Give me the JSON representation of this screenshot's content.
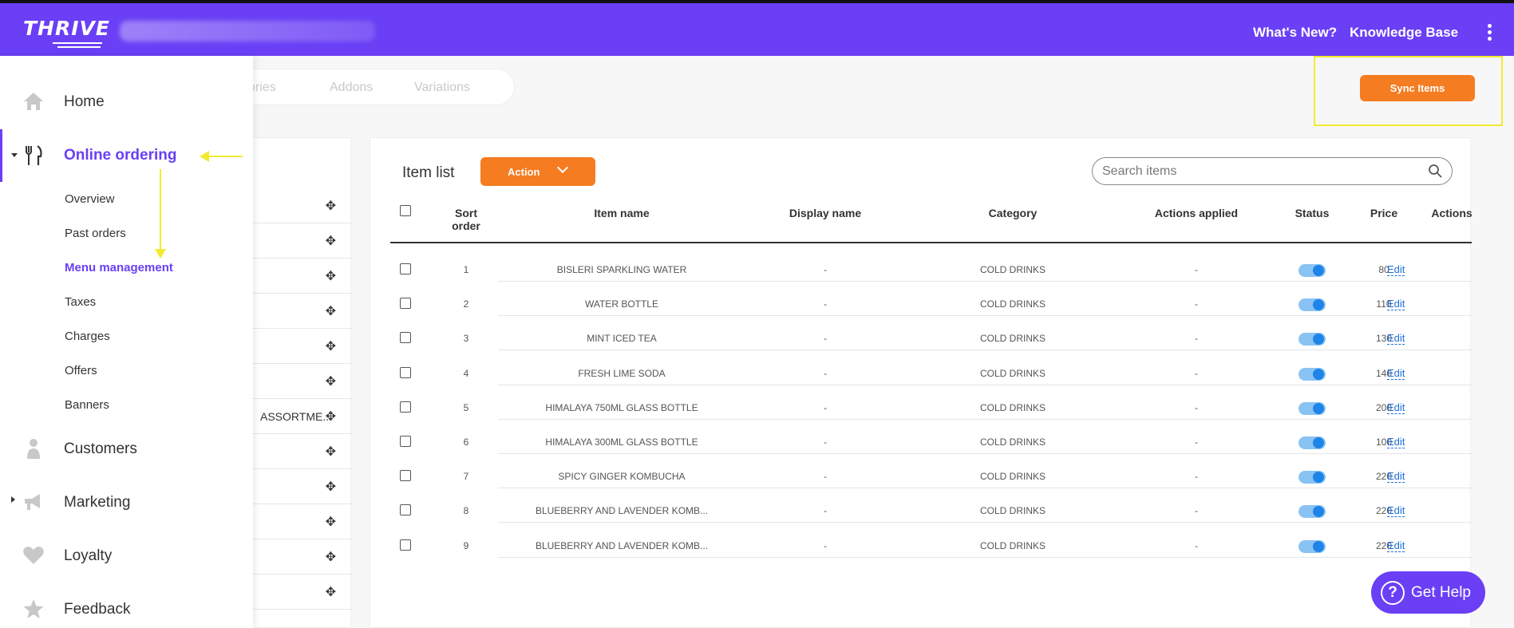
{
  "header": {
    "logo": "THRIVE",
    "links": [
      "What's New?",
      "Knowledge Base"
    ]
  },
  "tabs": [
    "ories",
    "Addons",
    "Variations"
  ],
  "sync_button": "Sync Items",
  "sidebar": {
    "main": [
      {
        "label": "Home",
        "icon": "home-icon"
      },
      {
        "label": "Online ordering",
        "icon": "fork-knife-icon"
      },
      {
        "label": "Customers",
        "icon": "user-icon"
      },
      {
        "label": "Marketing",
        "icon": "megaphone-icon"
      },
      {
        "label": "Loyalty",
        "icon": "heart-icon"
      },
      {
        "label": "Feedback",
        "icon": "star-icon"
      }
    ],
    "sub": [
      "Overview",
      "Past orders",
      "Menu management",
      "Taxes",
      "Charges",
      "Offers",
      "Banners"
    ],
    "active_color": "#6a3ff5"
  },
  "categories": {
    "partial_label": "ASSORTME..."
  },
  "item_list": {
    "title": "Item list",
    "action_label": "Action",
    "search_placeholder": "Search items",
    "columns": [
      "Sort order",
      "Item name",
      "Display name",
      "Category",
      "Actions applied",
      "Status",
      "Price",
      "Actions"
    ],
    "rows": [
      {
        "sort": "1",
        "name": "BISLERI SPARKLING WATER",
        "display": "-",
        "category": "COLD DRINKS",
        "applied": "-",
        "price": "80",
        "action": "Edit"
      },
      {
        "sort": "2",
        "name": "WATER BOTTLE",
        "display": "-",
        "category": "COLD DRINKS",
        "applied": "-",
        "price": "110",
        "action": "Edit"
      },
      {
        "sort": "3",
        "name": "MINT ICED TEA",
        "display": "-",
        "category": "COLD DRINKS",
        "applied": "-",
        "price": "130",
        "action": "Edit"
      },
      {
        "sort": "4",
        "name": "FRESH LIME SODA",
        "display": "-",
        "category": "COLD DRINKS",
        "applied": "-",
        "price": "140",
        "action": "Edit"
      },
      {
        "sort": "5",
        "name": "HIMALAYA 750ML GLASS BOTTLE",
        "display": "-",
        "category": "COLD DRINKS",
        "applied": "-",
        "price": "200",
        "action": "Edit"
      },
      {
        "sort": "6",
        "name": "HIMALAYA 300ML GLASS BOTTLE",
        "display": "-",
        "category": "COLD DRINKS",
        "applied": "-",
        "price": "100",
        "action": "Edit"
      },
      {
        "sort": "7",
        "name": "SPICY GINGER KOMBUCHA",
        "display": "-",
        "category": "COLD DRINKS",
        "applied": "-",
        "price": "220",
        "action": "Edit"
      },
      {
        "sort": "8",
        "name": "BLUEBERRY AND LAVENDER KOMB...",
        "display": "-",
        "category": "COLD DRINKS",
        "applied": "-",
        "price": "220",
        "action": "Edit"
      },
      {
        "sort": "9",
        "name": "BLUEBERRY AND LAVENDER KOMB...",
        "display": "-",
        "category": "COLD DRINKS",
        "applied": "-",
        "price": "220",
        "action": "Edit"
      }
    ]
  },
  "help_button": "Get Help",
  "colors": {
    "brand": "#6a3ff5",
    "accent": "#f57c20",
    "highlight": "#f3ea2f",
    "toggle_on": "#1f84e8"
  }
}
